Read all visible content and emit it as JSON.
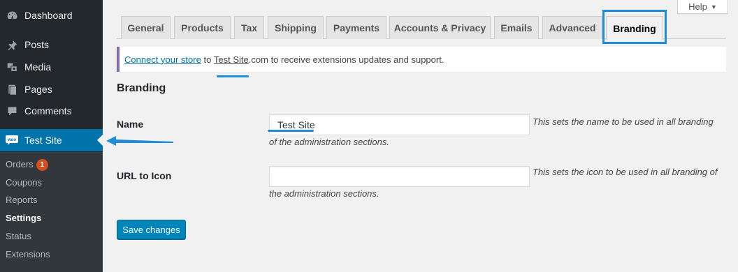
{
  "sidebar": {
    "items": [
      {
        "label": "Dashboard",
        "icon": "dashboard-icon"
      },
      {
        "label": "Posts",
        "icon": "pin-icon"
      },
      {
        "label": "Media",
        "icon": "media-icon"
      },
      {
        "label": "Pages",
        "icon": "pages-icon"
      },
      {
        "label": "Comments",
        "icon": "comments-icon"
      },
      {
        "label": "Test Site",
        "icon": "woo-icon"
      }
    ],
    "woo_icon_text": "woo",
    "submenu": [
      {
        "label": "Orders",
        "badge": "1"
      },
      {
        "label": "Coupons"
      },
      {
        "label": "Reports"
      },
      {
        "label": "Settings"
      },
      {
        "label": "Status"
      },
      {
        "label": "Extensions"
      }
    ]
  },
  "help": {
    "label": "Help",
    "caret": "▼"
  },
  "tabs": [
    {
      "label": "General"
    },
    {
      "label": "Products"
    },
    {
      "label": "Tax"
    },
    {
      "label": "Shipping"
    },
    {
      "label": "Payments"
    },
    {
      "label": "Accounts & Privacy"
    },
    {
      "label": "Emails"
    },
    {
      "label": "Advanced"
    },
    {
      "label": "Branding"
    }
  ],
  "notice": {
    "link_text": "Connect your store",
    "text_to": " to ",
    "site_name": "Test Site",
    "text_rest": ".com to receive extensions updates and support."
  },
  "section": {
    "title": "Branding"
  },
  "fields": {
    "name": {
      "label": "Name",
      "value": "Test Site",
      "desc_line1": "This sets the name to be used in all branding",
      "desc_line2": "of the administration sections."
    },
    "url_icon": {
      "label": "URL to Icon",
      "value": "",
      "desc_line1": "This sets the icon to be used in all branding of",
      "desc_line2": "the administration sections."
    }
  },
  "save_button": {
    "label": "Save changes"
  },
  "colors": {
    "accent": "#0073aa",
    "annotation": "#1e8cd8",
    "sidebar": "#23282d",
    "badge": "#d54e21"
  }
}
